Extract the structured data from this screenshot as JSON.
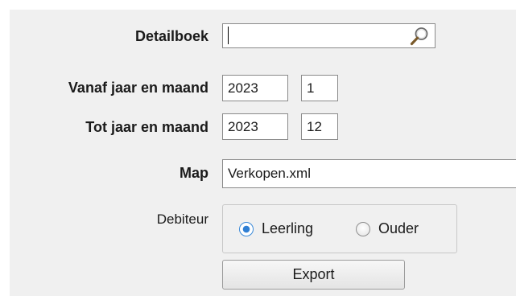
{
  "form": {
    "detailboek": {
      "label": "Detailboek",
      "value": "",
      "search_icon": "search-icon"
    },
    "vanaf": {
      "label": "Vanaf jaar en maand",
      "year": "2023",
      "month": "1"
    },
    "tot": {
      "label": "Tot jaar en maand",
      "year": "2023",
      "month": "12"
    },
    "map": {
      "label": "Map",
      "value": "Verkopen.xml"
    },
    "debiteur": {
      "label": "Debiteur",
      "options": [
        {
          "label": "Leerling",
          "selected": true
        },
        {
          "label": "Ouder",
          "selected": false
        }
      ]
    },
    "export_label": "Export"
  }
}
